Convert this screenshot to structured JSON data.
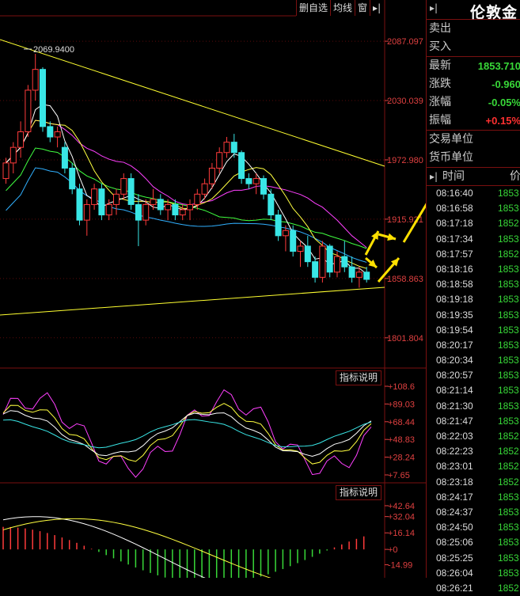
{
  "toolbar": {
    "items": [
      "删自选",
      "均线",
      "窗",
      "▸|"
    ]
  },
  "panel": {
    "title": "伦敦金",
    "pin": "▸|",
    "rows": [
      {
        "label": "卖出",
        "value": "",
        "color": "#ddd"
      },
      {
        "label": "买入",
        "value": "",
        "color": "#ddd"
      },
      {
        "label": "最新",
        "value": "1853.710",
        "color": "#38d838"
      },
      {
        "label": "涨跌",
        "value": "-0.960",
        "color": "#38d838"
      },
      {
        "label": "涨幅",
        "value": "-0.05%",
        "color": "#38d838"
      },
      {
        "label": "振幅",
        "value": "+0.15%",
        "color": "#ff3030"
      },
      {
        "label": "交易单位",
        "value": "",
        "color": "#ddd"
      },
      {
        "label": "货币单位",
        "value": "",
        "color": "#ddd"
      }
    ],
    "ticks_header": {
      "time": "时间",
      "price": "价"
    },
    "ticks": [
      {
        "time": "08:16:40",
        "price": "1853"
      },
      {
        "time": "08:16:58",
        "price": "1853"
      },
      {
        "time": "08:17:18",
        "price": "1852"
      },
      {
        "time": "08:17:34",
        "price": "1853"
      },
      {
        "time": "08:17:57",
        "price": "1852"
      },
      {
        "time": "08:18:16",
        "price": "1853"
      },
      {
        "time": "08:18:58",
        "price": "1853"
      },
      {
        "time": "08:19:18",
        "price": "1853"
      },
      {
        "time": "08:19:35",
        "price": "1853"
      },
      {
        "time": "08:19:54",
        "price": "1853"
      },
      {
        "time": "08:20:17",
        "price": "1853"
      },
      {
        "time": "08:20:34",
        "price": "1853"
      },
      {
        "time": "08:20:57",
        "price": "1853"
      },
      {
        "time": "08:21:14",
        "price": "1853"
      },
      {
        "time": "08:21:30",
        "price": "1853"
      },
      {
        "time": "08:21:47",
        "price": "1853"
      },
      {
        "time": "08:22:03",
        "price": "1852"
      },
      {
        "time": "08:22:23",
        "price": "1852"
      },
      {
        "time": "08:23:01",
        "price": "1852"
      },
      {
        "time": "08:23:18",
        "price": "1852"
      },
      {
        "time": "08:24:17",
        "price": "1853"
      },
      {
        "time": "08:24:37",
        "price": "1853"
      },
      {
        "time": "08:24:50",
        "price": "1853"
      },
      {
        "time": "08:25:06",
        "price": "1853"
      },
      {
        "time": "08:25:25",
        "price": "1853"
      },
      {
        "time": "08:26:04",
        "price": "1853"
      },
      {
        "time": "08:26:21",
        "price": "1852"
      }
    ]
  },
  "help_label": "指标说明",
  "chart_data": [
    {
      "type": "candlestick",
      "yticks": [
        2087.097,
        2030.039,
        1972.98,
        1915.921,
        1858.863,
        1801.804
      ],
      "ylim": [
        1775,
        2110
      ],
      "annotation": "2069.9400",
      "colors": {
        "up": "#ff3b3b",
        "down": "#39e6e6",
        "ma5": "#ffffff",
        "ma10": "#ffff40",
        "ma20": "#ff40ff",
        "ma30": "#40ff40",
        "ma60": "#30b0ff",
        "trend": "#ffff30"
      },
      "candles": [
        [
          1955,
          1975,
          1950,
          1970
        ],
        [
          1970,
          1990,
          1960,
          1985
        ],
        [
          1985,
          2010,
          1975,
          2000
        ],
        [
          2000,
          2045,
          1995,
          2040
        ],
        [
          2040,
          2075,
          2030,
          2060
        ],
        [
          2060,
          2062,
          2000,
          2005
        ],
        [
          2005,
          2010,
          1990,
          1995
        ],
        [
          1995,
          2005,
          1985,
          2000
        ],
        [
          1985,
          1990,
          1960,
          1965
        ],
        [
          1965,
          1970,
          1940,
          1945
        ],
        [
          1945,
          1950,
          1910,
          1915
        ],
        [
          1915,
          1935,
          1900,
          1930
        ],
        [
          1930,
          1950,
          1925,
          1945
        ],
        [
          1945,
          1950,
          1915,
          1920
        ],
        [
          1920,
          1935,
          1915,
          1930
        ],
        [
          1930,
          1945,
          1920,
          1940
        ],
        [
          1940,
          1960,
          1935,
          1955
        ],
        [
          1955,
          1960,
          1925,
          1930
        ],
        [
          1930,
          1940,
          1890,
          1915
        ],
        [
          1915,
          1935,
          1910,
          1930
        ],
        [
          1930,
          1945,
          1925,
          1935
        ],
        [
          1935,
          1940,
          1920,
          1925
        ],
        [
          1925,
          1935,
          1915,
          1930
        ],
        [
          1930,
          1935,
          1915,
          1920
        ],
        [
          1920,
          1930,
          1915,
          1925
        ],
        [
          1925,
          1935,
          1915,
          1930
        ],
        [
          1930,
          1945,
          1925,
          1940
        ],
        [
          1940,
          1955,
          1935,
          1950
        ],
        [
          1950,
          1970,
          1945,
          1965
        ],
        [
          1965,
          1985,
          1960,
          1980
        ],
        [
          1980,
          1995,
          1975,
          1990
        ],
        [
          1990,
          1998,
          1975,
          1980
        ],
        [
          1980,
          1982,
          1950,
          1955
        ],
        [
          1955,
          1960,
          1945,
          1950
        ],
        [
          1950,
          1960,
          1940,
          1955
        ],
        [
          1955,
          1958,
          1935,
          1940
        ],
        [
          1940,
          1945,
          1915,
          1920
        ],
        [
          1920,
          1925,
          1895,
          1900
        ],
        [
          1900,
          1910,
          1885,
          1905
        ],
        [
          1905,
          1910,
          1880,
          1885
        ],
        [
          1885,
          1895,
          1870,
          1890
        ],
        [
          1890,
          1900,
          1870,
          1875
        ],
        [
          1875,
          1880,
          1855,
          1860
        ],
        [
          1860,
          1895,
          1855,
          1890
        ],
        [
          1890,
          1892,
          1860,
          1865
        ],
        [
          1865,
          1885,
          1860,
          1880
        ],
        [
          1880,
          1895,
          1865,
          1870
        ],
        [
          1870,
          1880,
          1855,
          1860
        ],
        [
          1860,
          1870,
          1850,
          1865
        ],
        [
          1865,
          1870,
          1855,
          1858
        ]
      ]
    },
    {
      "type": "line",
      "name": "oscillator",
      "yticks": [
        "+108.6",
        "+89.03",
        "+68.44",
        "+48.83",
        "+28.24",
        "+7.65"
      ],
      "ylim": [
        0,
        118
      ]
    },
    {
      "type": "bar",
      "name": "macd",
      "yticks": [
        "+42.64",
        "+32.04",
        "+16.14",
        "+0",
        "-14.99"
      ],
      "ylim": [
        -20,
        48
      ]
    }
  ]
}
